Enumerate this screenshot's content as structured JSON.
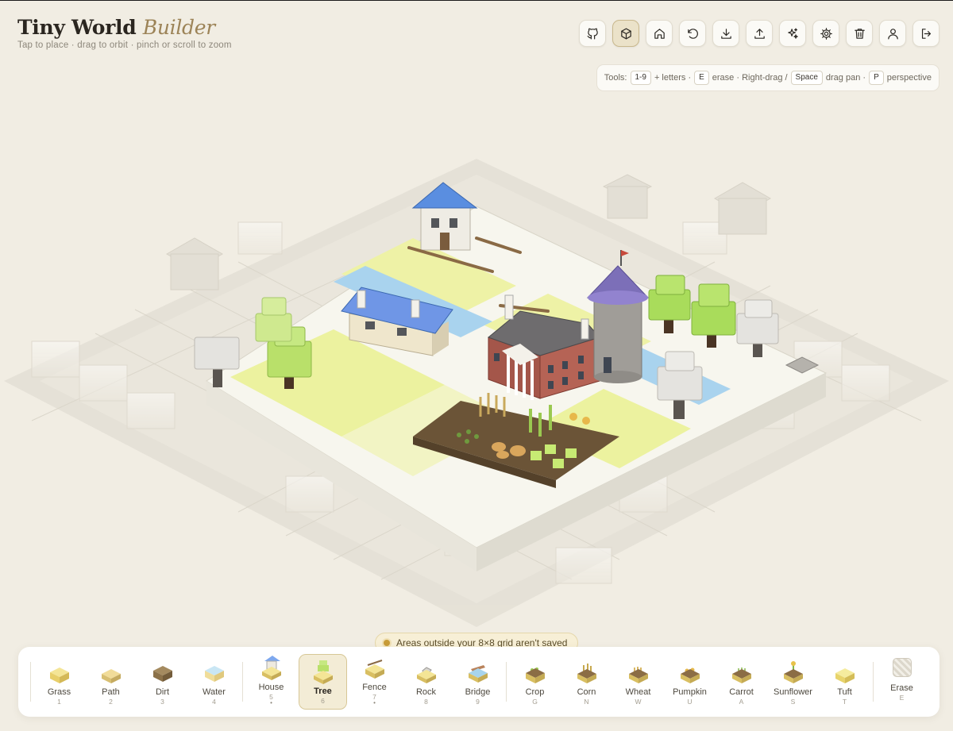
{
  "app": {
    "title_main": "Tiny World",
    "title_accent": "Builder",
    "subtitle": "Tap to place · drag to orbit · pinch or scroll to zoom"
  },
  "toolbar": [
    {
      "name": "github-button",
      "icon": "github-icon"
    },
    {
      "name": "view-3d-button",
      "icon": "cube-icon",
      "active": true
    },
    {
      "name": "home-button",
      "icon": "home-icon"
    },
    {
      "name": "undo-button",
      "icon": "undo-icon"
    },
    {
      "name": "download-button",
      "icon": "download-icon"
    },
    {
      "name": "upload-button",
      "icon": "upload-icon"
    },
    {
      "name": "magic-button",
      "icon": "sparkles-icon"
    },
    {
      "name": "settings-button",
      "icon": "gear-icon"
    },
    {
      "name": "clear-button",
      "icon": "trash-icon"
    },
    {
      "name": "account-button",
      "icon": "user-icon"
    },
    {
      "name": "logout-button",
      "icon": "logout-icon"
    }
  ],
  "hint": {
    "prefix": "Tools:",
    "k1": "1-9",
    "t1": "+ letters ·",
    "k2": "E",
    "t2": "erase · Right-drag /",
    "k3": "Space",
    "t3": "drag pan ·",
    "k4": "P",
    "t4": "perspective"
  },
  "notice": "Areas outside your 8×8 grid aren't saved",
  "palette": {
    "terrain": [
      {
        "label": "Grass",
        "key": "1",
        "color": "#f0dc86"
      },
      {
        "label": "Path",
        "key": "2",
        "color": "#e7cf85"
      },
      {
        "label": "Dirt",
        "key": "3",
        "color": "#a58b60"
      },
      {
        "label": "Water",
        "key": "4",
        "color": "#bfe0ee"
      }
    ],
    "objects": [
      {
        "label": "House",
        "key": "5",
        "dot": "•"
      },
      {
        "label": "Tree",
        "key": "6",
        "active": true
      },
      {
        "label": "Fence",
        "key": "7",
        "dot": "•"
      },
      {
        "label": "Rock",
        "key": "8"
      },
      {
        "label": "Bridge",
        "key": "9"
      }
    ],
    "crops": [
      {
        "label": "Crop",
        "key": "G"
      },
      {
        "label": "Corn",
        "key": "N"
      },
      {
        "label": "Wheat",
        "key": "W"
      },
      {
        "label": "Pumpkin",
        "key": "U"
      },
      {
        "label": "Carrot",
        "key": "A"
      },
      {
        "label": "Sunflower",
        "key": "S"
      },
      {
        "label": "Tuft",
        "key": "T"
      }
    ],
    "erase": {
      "label": "Erase",
      "key": "E"
    }
  }
}
